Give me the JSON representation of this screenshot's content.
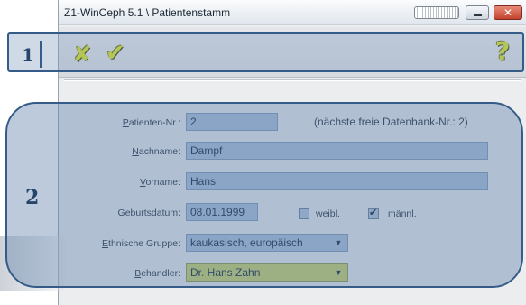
{
  "window": {
    "title": "Z1-WinCeph 5.1 \\ Patientenstamm",
    "close_label": "✕"
  },
  "toolbar": {
    "cancel_icon": "x-cancel-icon",
    "ok_icon": "checkmark-icon",
    "help_icon": "help-question-icon"
  },
  "callouts": {
    "one": "1",
    "two": "2"
  },
  "form": {
    "patient_nr": {
      "label_first": "P",
      "label_rest": "atienten-Nr.:",
      "value": "2"
    },
    "next_free_note": "(nächste freie Datenbank-Nr.: 2)",
    "nachname": {
      "label_first": "N",
      "label_rest": "achname:",
      "value": "Dampf"
    },
    "vorname": {
      "label_first": "V",
      "label_rest": "orname:",
      "value": "Hans"
    },
    "geburtsdatum": {
      "label_first": "G",
      "label_rest": "eburtsdatum:",
      "value": "08.01.1999"
    },
    "gender": {
      "female_label": "weibl.",
      "female_checked": false,
      "male_label": "männl.",
      "male_checked": true
    },
    "ethnic": {
      "label_first": "E",
      "label_rest": "thnische Gruppe:",
      "value": "kaukasisch, europäisch"
    },
    "behandler": {
      "label_first": "B",
      "label_rest": "ehandler:",
      "value": "Dr. Hans Zahn"
    }
  }
}
